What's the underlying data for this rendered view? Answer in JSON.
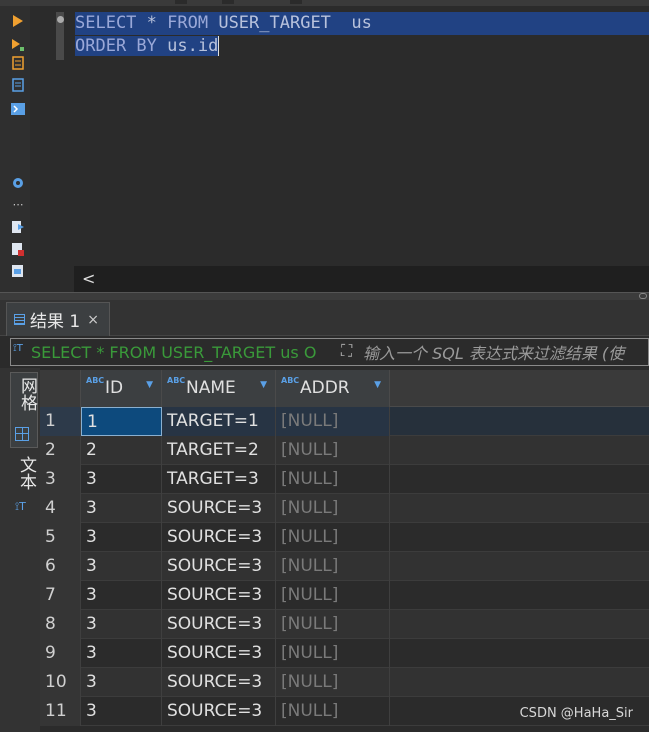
{
  "editor": {
    "line1": {
      "kw_select": "SELECT",
      "star": " * ",
      "kw_from": "FROM",
      "rest": " USER_TARGET  us"
    },
    "line2": {
      "kw_order": "ORDER BY",
      "rest": " us.id"
    },
    "scroll_left": "<"
  },
  "results": {
    "tab_label": "结果 1",
    "close": "×",
    "filter_sql": "SELECT * FROM USER_TARGET us O",
    "filter_placeholder": "输入一个 SQL 表达式来过滤结果 (使",
    "vtab_grid": "网格",
    "vtab_text": "文本",
    "columns": [
      {
        "type": "ABC",
        "name": "ID"
      },
      {
        "type": "ABC",
        "name": "NAME"
      },
      {
        "type": "ABC",
        "name": "ADDR"
      }
    ],
    "rows": [
      {
        "n": "1",
        "id": "1",
        "name": "TARGET=1",
        "addr": "[NULL]"
      },
      {
        "n": "2",
        "id": "2",
        "name": "TARGET=2",
        "addr": "[NULL]"
      },
      {
        "n": "3",
        "id": "3",
        "name": "TARGET=3",
        "addr": "[NULL]"
      },
      {
        "n": "4",
        "id": "3",
        "name": "SOURCE=3",
        "addr": "[NULL]"
      },
      {
        "n": "5",
        "id": "3",
        "name": "SOURCE=3",
        "addr": "[NULL]"
      },
      {
        "n": "6",
        "id": "3",
        "name": "SOURCE=3",
        "addr": "[NULL]"
      },
      {
        "n": "7",
        "id": "3",
        "name": "SOURCE=3",
        "addr": "[NULL]"
      },
      {
        "n": "8",
        "id": "3",
        "name": "SOURCE=3",
        "addr": "[NULL]"
      },
      {
        "n": "9",
        "id": "3",
        "name": "SOURCE=3",
        "addr": "[NULL]"
      },
      {
        "n": "10",
        "id": "3",
        "name": "SOURCE=3",
        "addr": "[NULL]"
      },
      {
        "n": "11",
        "id": "3",
        "name": "SOURCE=3",
        "addr": "[NULL]"
      }
    ]
  },
  "watermark": "CSDN @HaHa_Sir",
  "icons": {
    "run": "run-statement-icon",
    "run_new": "run-new-tab-icon",
    "explain": "explain-plan-icon",
    "script": "script-icon",
    "console": "console-icon",
    "settings": "settings-gear-icon",
    "more": "more-icon",
    "export": "export-icon",
    "import": "import-icon",
    "format": "format-icon"
  },
  "colors": {
    "selection": "#214283",
    "keyword": "#cc7832",
    "accent": "#5aa0e6",
    "filter_sql": "#3a9a3a"
  }
}
